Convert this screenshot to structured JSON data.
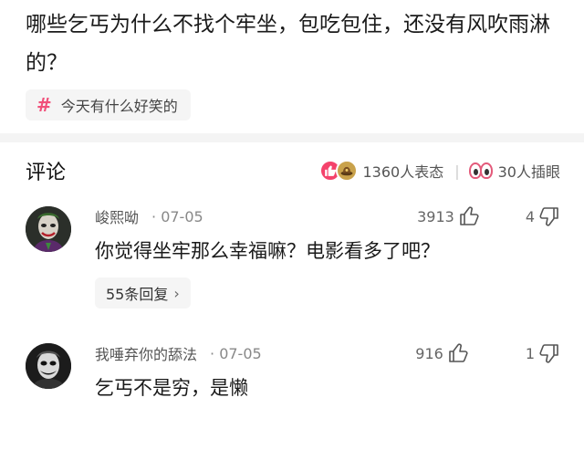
{
  "post": {
    "question": "哪些乞丐为什么不找个牢坐，包吃包住，还没有风吹雨淋的？",
    "topic_icon": "hash-icon",
    "topic_label": "今天有什么好笑的"
  },
  "comments_section": {
    "title": "评论",
    "reactions_text": "1360人表态",
    "separator": "|",
    "collect_text": "30人插眼",
    "like_color": "#f4426b"
  },
  "comments": [
    {
      "name": "峻熙呦",
      "date": "· 07-05",
      "likes": "3913",
      "dislikes": "4",
      "text": "你觉得坐牢那么幸福嘛？电影看多了吧？",
      "replies_label": "55条回复",
      "replies_chevron": "›"
    },
    {
      "name": "我唾弃你的舔法",
      "date": "· 07-05",
      "likes": "916",
      "dislikes": "1",
      "text": "乞丐不是穷，是懒"
    }
  ]
}
